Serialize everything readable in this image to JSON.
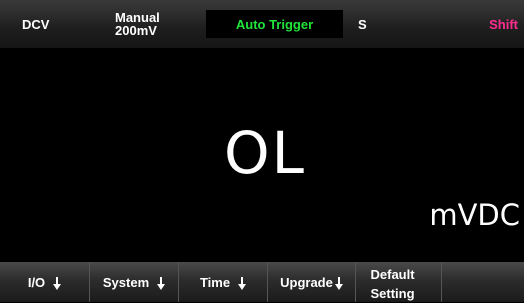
{
  "status_bar": {
    "mode": "DCV",
    "range_mode": "Manual",
    "range_value": "200mV",
    "trigger": "Auto Trigger",
    "speed": "S",
    "shift": "Shift"
  },
  "display": {
    "reading": "OL",
    "unit": "mVDC"
  },
  "softkeys": [
    {
      "label": "I/O",
      "has_arrow": true
    },
    {
      "label": "System",
      "has_arrow": true
    },
    {
      "label": "Time",
      "has_arrow": true
    },
    {
      "label": "Upgrade",
      "has_arrow": true
    },
    {
      "label": "Default Setting",
      "has_arrow": false
    },
    {
      "label": "",
      "has_arrow": false
    }
  ],
  "colors": {
    "trigger_text": "#22e33a",
    "shift_text": "#ff2d8f",
    "background": "#000000"
  },
  "icons": {
    "softkey_arrow": "arrow-down-icon"
  }
}
